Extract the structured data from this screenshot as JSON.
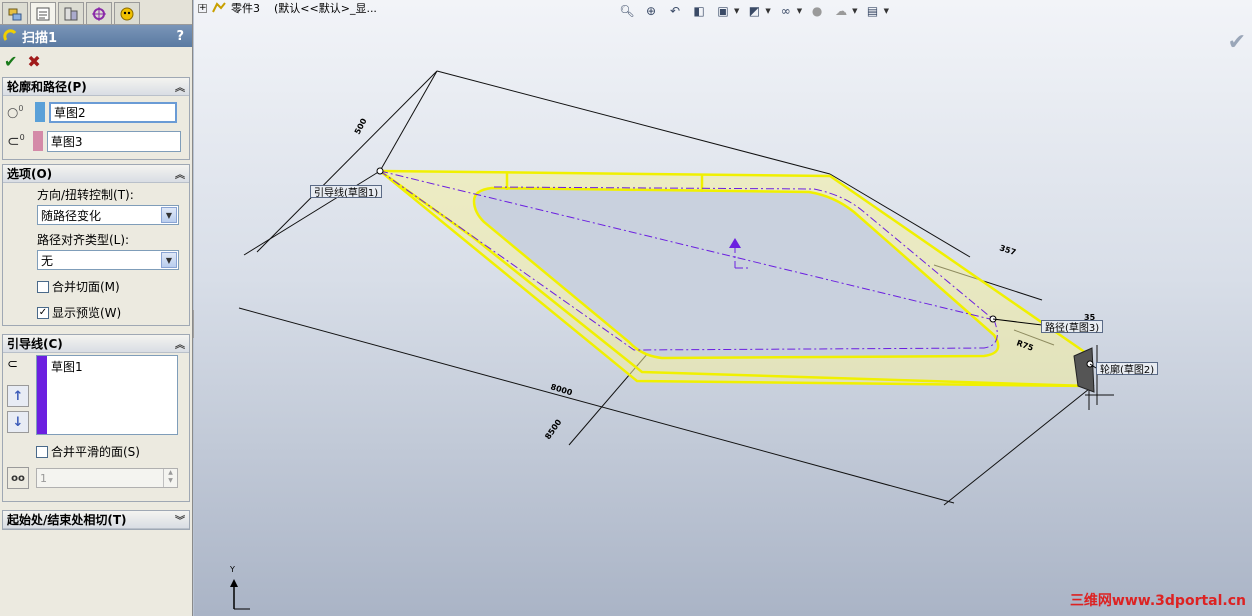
{
  "property_manager": {
    "tabs": [
      "feature-manager-icon",
      "property-manager-icon",
      "configuration-manager-icon",
      "dimxpert-icon",
      "display-manager-icon"
    ],
    "title": "扫描1",
    "help": "?",
    "sections": {
      "profile_path": {
        "title": "轮廓和路径(P)",
        "profile_value": "草图2",
        "path_value": "草图3"
      },
      "options": {
        "title": "选项(O)",
        "orientation_label": "方向/扭转控制(T):",
        "orientation_value": "随路径变化",
        "path_align_label": "路径对齐类型(L):",
        "path_align_value": "无",
        "merge_tangent_label": "合并切面(M)",
        "merge_tangent_checked": false,
        "show_preview_label": "显示预览(W)",
        "show_preview_checked": true
      },
      "guide_curves": {
        "title": "引导线(C)",
        "items": [
          "草图1"
        ],
        "merge_smooth_label": "合并平滑的面(S)",
        "merge_smooth_checked": false,
        "sections_value": "1"
      },
      "start_end": {
        "title": "起始处/结束处相切(T)"
      }
    }
  },
  "viewport": {
    "breadcrumb_part": "零件3",
    "breadcrumb_config": "(默认<<默认>_显...",
    "callouts": {
      "guide": "引导线(草图1)",
      "path": "路径(草图3)",
      "profile": "轮廓(草图2)"
    },
    "dimensions": [
      "500",
      "357",
      "35",
      "R75",
      "8000",
      "8500"
    ],
    "triad_label": "Y",
    "watermark": "三维网www.3dportal.cn"
  },
  "colors": {
    "title_bar": "#5a7aa2",
    "sweep_edge": "#f0f000",
    "guide_line": "#6b1fe0",
    "profile_swatch": "#5aa0d8",
    "path_swatch": "#d48aa8",
    "watermark": "#dd2222"
  }
}
